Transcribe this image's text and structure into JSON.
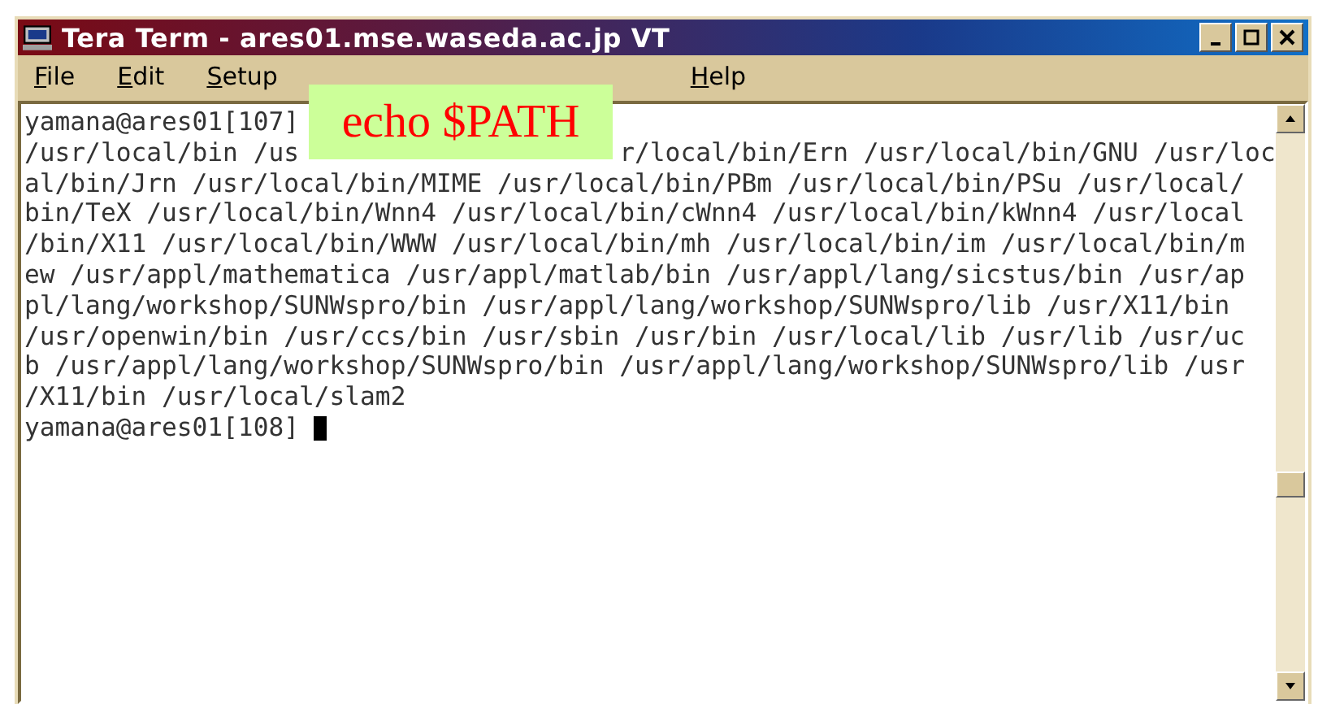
{
  "window": {
    "title": "Tera Term - ares01.mse.waseda.ac.jp VT"
  },
  "menu": [
    {
      "label": "File"
    },
    {
      "label": "Edit"
    },
    {
      "label": "Setup"
    },
    {
      "label": "Help"
    }
  ],
  "terminal": {
    "lines": [
      {
        "text": "yamana@ares01[107]"
      },
      {
        "text": "/usr/local/bin /us",
        "continued": "r/local/bin/Ern /usr/local/bin/GNU /usr/loc"
      },
      {
        "text": "al/bin/Jrn /usr/local/bin/MIME /usr/local/bin/PBm /usr/local/bin/PSu /usr/local/"
      },
      {
        "text": "bin/TeX /usr/local/bin/Wnn4 /usr/local/bin/cWnn4 /usr/local/bin/kWnn4 /usr/local"
      },
      {
        "text": "/bin/X11 /usr/local/bin/WWW /usr/local/bin/mh /usr/local/bin/im /usr/local/bin/m"
      },
      {
        "text": "ew /usr/appl/mathematica /usr/appl/matlab/bin /usr/appl/lang/sicstus/bin /usr/ap"
      },
      {
        "text": "pl/lang/workshop/SUNWspro/bin /usr/appl/lang/workshop/SUNWspro/lib /usr/X11/bin"
      },
      {
        "text": "/usr/openwin/bin /usr/ccs/bin /usr/sbin /usr/bin /usr/local/lib /usr/lib /usr/uc"
      },
      {
        "text": "b /usr/appl/lang/workshop/SUNWspro/bin /usr/appl/lang/workshop/SUNWspro/lib /usr"
      },
      {
        "text": "/X11/bin /usr/local/slam2"
      },
      {
        "text": "yamana@ares01[108]",
        "cursor": true
      }
    ]
  },
  "caption": {
    "text": "echo $PATH"
  }
}
